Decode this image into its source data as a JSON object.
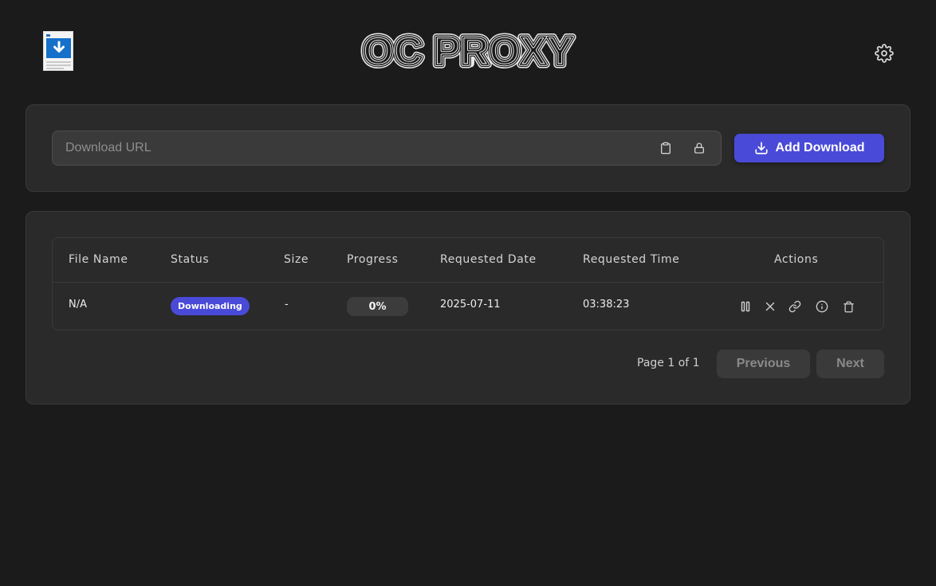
{
  "header": {
    "brand_text": "OC PROXY",
    "logo_icon": "download-file-icon",
    "settings_icon": "gear-icon"
  },
  "url_form": {
    "placeholder": "Download URL",
    "value": "",
    "paste_icon": "clipboard-icon",
    "lock_icon": "lock-icon",
    "add_button_label": "Add Download",
    "add_button_icon": "download-icon"
  },
  "table": {
    "columns": [
      "File Name",
      "Status",
      "Size",
      "Progress",
      "Requested Date",
      "Requested Time",
      "Actions"
    ],
    "rows": [
      {
        "file_name": "N/A",
        "status": "Downloading",
        "size": "-",
        "progress": "0%",
        "progress_fraction": 0,
        "requested_date": "2025-07-11",
        "requested_time": "03:38:23",
        "actions": [
          "pause-icon",
          "cancel-icon",
          "link-icon",
          "info-icon",
          "trash-icon"
        ]
      }
    ]
  },
  "pagination": {
    "label": "Page 1 of 1",
    "previous_label": "Previous",
    "next_label": "Next"
  },
  "colors": {
    "background": "#1b1b1b",
    "card": "#2a2a2a",
    "accent": "#4a4ad8",
    "muted_button": "#3a3a3a"
  }
}
